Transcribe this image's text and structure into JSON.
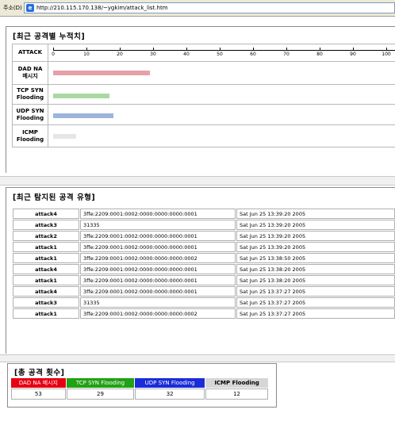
{
  "address": {
    "label": "주소(D)",
    "url": "http://210.115.170.138/~ygkim/attack_list.htm"
  },
  "cumulative": {
    "title": "[최근 공격별 누적치]",
    "axis_label": "ATTACK",
    "ticks": [
      "0",
      "10",
      "20",
      "30",
      "40",
      "50",
      "60",
      "70",
      "80",
      "90",
      "100"
    ],
    "rows": [
      {
        "label_line1": "DAD NA",
        "label_line2": "메시지",
        "value": 29,
        "color": "#e8a0a8"
      },
      {
        "label_line1": "TCP SYN",
        "label_line2": "Flooding",
        "value": 17,
        "color": "#a9d8a3"
      },
      {
        "label_line1": "UDP SYN",
        "label_line2": "Flooding",
        "value": 18,
        "color": "#9db5dc"
      },
      {
        "label_line1": "ICMP",
        "label_line2": "Flooding",
        "value": 7,
        "color": "#e6e6e6"
      }
    ]
  },
  "recent": {
    "title": "[최근 탐지된 공격 유형]",
    "rows": [
      {
        "name": "attack4",
        "addr": "3ffe:2209:0001:0002:0000:0000:0000:0001",
        "time": "Sat Jun 25 13:39:20 2005"
      },
      {
        "name": "attack3",
        "addr": "31335",
        "time": "Sat Jun 25 13:39:20 2005"
      },
      {
        "name": "attack2",
        "addr": "3ffe:2209:0001:0002:0000:0000:0000:0001",
        "time": "Sat Jun 25 13:39:20 2005"
      },
      {
        "name": "attack1",
        "addr": "3ffe:2209:0001:0002:0000:0000:0000:0001",
        "time": "Sat Jun 25 13:39:20 2005"
      },
      {
        "name": "attack1",
        "addr": "3ffe:2209:0001:0002:0000:0000:0000:0002",
        "time": "Sat Jun 25 13:38:50 2005"
      },
      {
        "name": "attack4",
        "addr": "3ffe:2209:0001:0002:0000:0000:0000:0001",
        "time": "Sat Jun 25 13:38:20 2005"
      },
      {
        "name": "attack1",
        "addr": "3ffe:2209:0001:0002:0000:0000:0000:0001",
        "time": "Sat Jun 25 13:38:20 2005"
      },
      {
        "name": "attack4",
        "addr": "3ffe:2209:0001:0002:0000:0000:0000:0001",
        "time": "Sat Jun 25 13:37:27 2005"
      },
      {
        "name": "attack3",
        "addr": "31335",
        "time": "Sat Jun 25 13:37:27 2005"
      },
      {
        "name": "attack1",
        "addr": "3ffe:2209:0001:0002:0000:0000:0000:0002",
        "time": "Sat Jun 25 13:37:27 2005"
      }
    ]
  },
  "totals": {
    "title": "[총 공격 횟수]",
    "headers": [
      "DAD NA 메시지",
      "TCP SYN Flooding",
      "UDP SYN Flooding",
      "ICMP Flooding"
    ],
    "values": [
      "53",
      "29",
      "32",
      "12"
    ]
  }
}
